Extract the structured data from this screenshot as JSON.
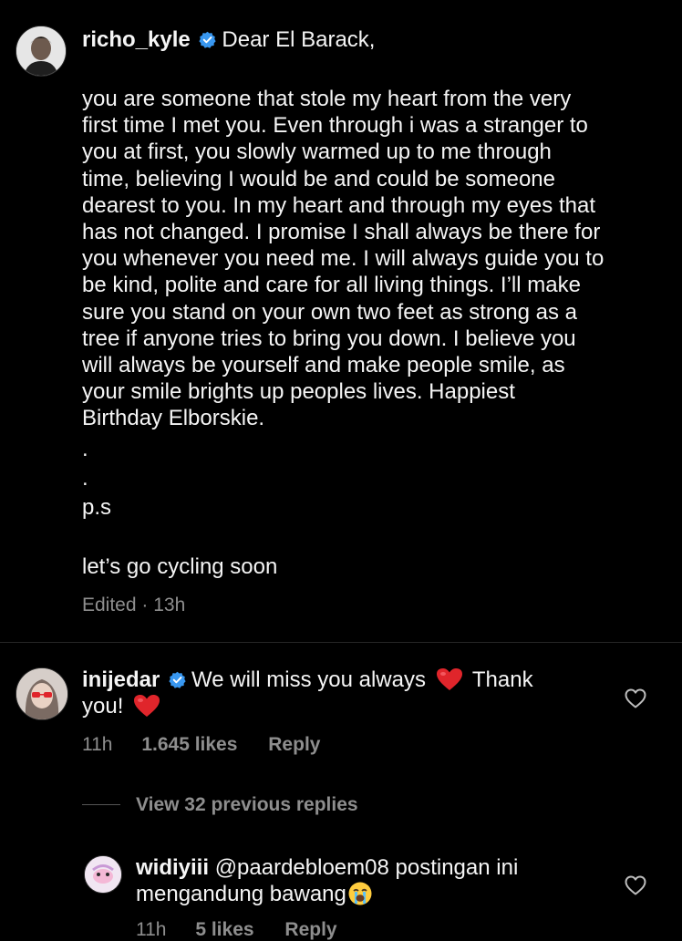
{
  "caption": {
    "username": "richo_kyle",
    "greeting": "Dear El Barack,",
    "paragraph_lines": [
      "you are someone that stole my heart from the very",
      "first time I met you. Even through i was a stranger to",
      "you at first, you slowly warmed up to me through",
      "time, believing I would be and could be someone",
      "dearest to you. In my heart and through my eyes that",
      "has not changed. I promise I shall always be there for",
      "you whenever you need me. I will always guide you to",
      "be kind, polite and care for all living things. I’ll make",
      "sure you stand on your own two feet as strong as a",
      "tree if anyone tries to bring you down. I believe you",
      "will always be yourself and make people smile, as",
      "your smile brights up peoples lives. Happiest",
      "Birthday Elborskie."
    ],
    "dot1": ".",
    "dot2": ".",
    "ps": "p.s",
    "closing": "let’s go cycling soon",
    "edited": "Edited · 13h"
  },
  "comment1": {
    "username": "inijedar",
    "text_part1": "We will miss you always",
    "text_part2": "Thank",
    "text_line2": "you!",
    "emoji_heart": "❤️",
    "time": "11h",
    "likes": "1.645 likes",
    "reply": "Reply"
  },
  "view_replies": "View 32 previous replies",
  "reply1": {
    "username": "widiyiii",
    "text_line1": "@paardebloem08 postingan ini",
    "text_line2": "mengandung bawang",
    "emoji_cry": "😭",
    "time": "11h",
    "likes": "5 likes",
    "reply": "Reply"
  },
  "icons": {
    "verified": "verified-badge-icon",
    "like": "heart-outline-icon",
    "emoji_heart": "red-heart-emoji-icon",
    "emoji_cry": "loudly-crying-emoji-icon"
  },
  "colors": {
    "background": "#000000",
    "text": "#f5f5f5",
    "muted": "#8e8e8e",
    "verified": "#3897f0",
    "heart": "#e0252b"
  }
}
